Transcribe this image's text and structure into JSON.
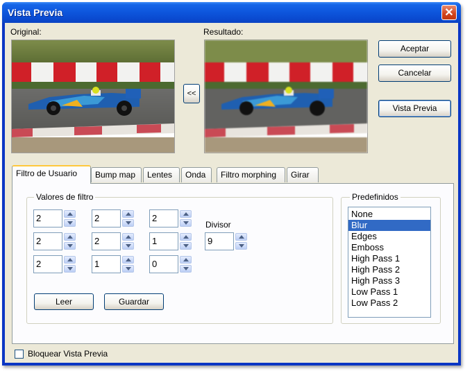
{
  "window": {
    "title": "Vista Previa",
    "close_glyph": "✕"
  },
  "previews": {
    "original_label": "Original:",
    "result_label": "Resultado:",
    "copy_button": "<<"
  },
  "buttons": {
    "accept": "Aceptar",
    "cancel": "Cancelar",
    "preview": "Vista Previa"
  },
  "tabs": [
    {
      "label": "Filtro de Usuario",
      "active": true
    },
    {
      "label": "Bump map"
    },
    {
      "label": "Lentes"
    },
    {
      "label": "Onda"
    },
    {
      "label": "Filtro morphing"
    },
    {
      "label": "Girar"
    }
  ],
  "filter_values": {
    "title": "Valores de filtro",
    "matrix": [
      [
        "2",
        "2",
        "2"
      ],
      [
        "2",
        "2",
        "1"
      ],
      [
        "2",
        "1",
        "0"
      ]
    ],
    "divisor_label": "Divisor",
    "divisor": "9",
    "read_button": "Leer",
    "save_button": "Guardar"
  },
  "presets": {
    "title": "Predefinidos",
    "items": [
      "None",
      "Blur",
      "Edges",
      "Emboss",
      "High Pass 1",
      "High Pass 2",
      "High Pass 3",
      "Low Pass 1",
      "Low Pass 2"
    ],
    "selected": "Blur"
  },
  "lock_preview": {
    "label": "Bloquear Vista Previa",
    "checked": false
  },
  "colors": {
    "titlebar": "#0a55dc",
    "face": "#ece9d8",
    "selection": "#316ac5",
    "tab_highlight": "#ffc83c"
  }
}
